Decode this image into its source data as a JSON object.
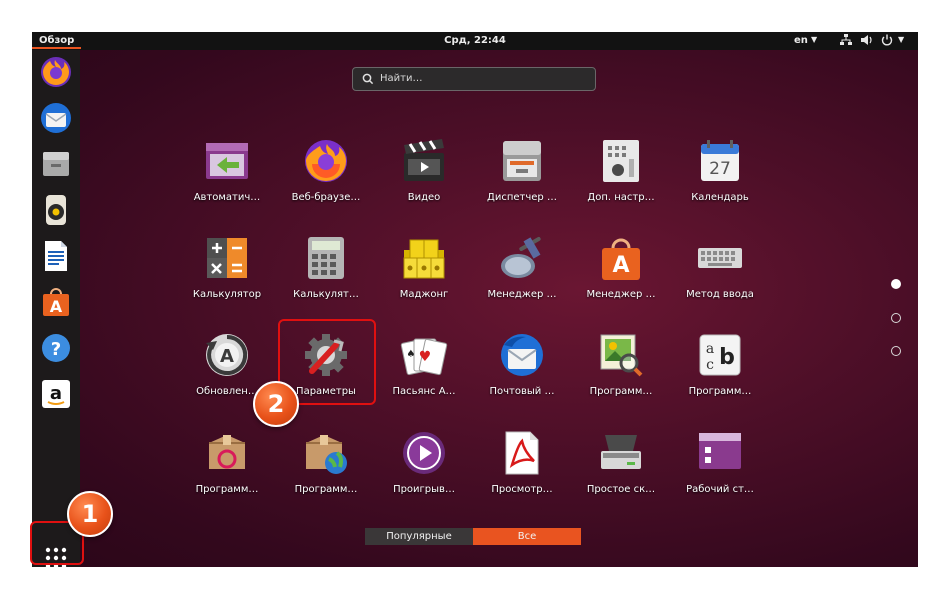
{
  "topbar": {
    "activities": "Обзор",
    "clock": "Срд, 22:44",
    "language": "en",
    "tray_icons": [
      "network-icon",
      "volume-icon",
      "power-icon"
    ]
  },
  "dock": {
    "items": [
      "firefox-icon",
      "thunderbird-icon",
      "files-icon",
      "rhythmbox-icon",
      "writer-icon",
      "software-icon",
      "help-icon",
      "amazon-icon"
    ],
    "show_apps_icon": "grid-icon"
  },
  "search": {
    "placeholder": "Найти…"
  },
  "apps": [
    {
      "label": "Автоматич…",
      "icon": "startup-apps-icon"
    },
    {
      "label": "Веб-браузе…",
      "icon": "firefox-icon"
    },
    {
      "label": "Видео",
      "icon": "video-icon"
    },
    {
      "label": "Диспетчер …",
      "icon": "file-manager-icon"
    },
    {
      "label": "Доп. настр…",
      "icon": "tweaks-icon"
    },
    {
      "label": "Календарь",
      "icon": "calendar-icon",
      "value": "27"
    },
    {
      "label": "Калькулятор",
      "icon": "calculator-icon"
    },
    {
      "label": "Калькулят…",
      "icon": "calculator-classic-icon"
    },
    {
      "label": "Маджонг",
      "icon": "mahjongg-icon"
    },
    {
      "label": "Менеджер …",
      "icon": "disk-manager-icon"
    },
    {
      "label": "Менеджер …",
      "icon": "software-icon"
    },
    {
      "label": "Метод ввода",
      "icon": "keyboard-icon"
    },
    {
      "label": "Обновлен…",
      "icon": "updater-icon"
    },
    {
      "label": "Параметры",
      "icon": "settings-icon"
    },
    {
      "label": "Пасьянс А…",
      "icon": "solitaire-icon"
    },
    {
      "label": "Почтовый …",
      "icon": "thunderbird-icon"
    },
    {
      "label": "Программ…",
      "icon": "image-viewer-icon"
    },
    {
      "label": "Программ…",
      "icon": "character-map-icon",
      "glyph": "b"
    },
    {
      "label": "Программ…",
      "icon": "debian-package-icon"
    },
    {
      "label": "Программ…",
      "icon": "package-globe-icon"
    },
    {
      "label": "Проигрыв…",
      "icon": "media-player-icon"
    },
    {
      "label": "Просмотр…",
      "icon": "document-viewer-icon"
    },
    {
      "label": "Простое ск…",
      "icon": "scanner-icon"
    },
    {
      "label": "Рабочий ст…",
      "icon": "desktop-sharing-icon"
    }
  ],
  "pager": {
    "pages": 3,
    "current": 1
  },
  "view_switch": {
    "popular": "Популярные",
    "all": "Все",
    "selected": "all"
  },
  "annotations": [
    {
      "number": "1",
      "target": "show-apps-button"
    },
    {
      "number": "2",
      "target": "app-settings"
    }
  ],
  "colors": {
    "accent": "#e95420",
    "highlight": "#e01010",
    "panel": "#121212",
    "dock": "#1d1a1b"
  }
}
